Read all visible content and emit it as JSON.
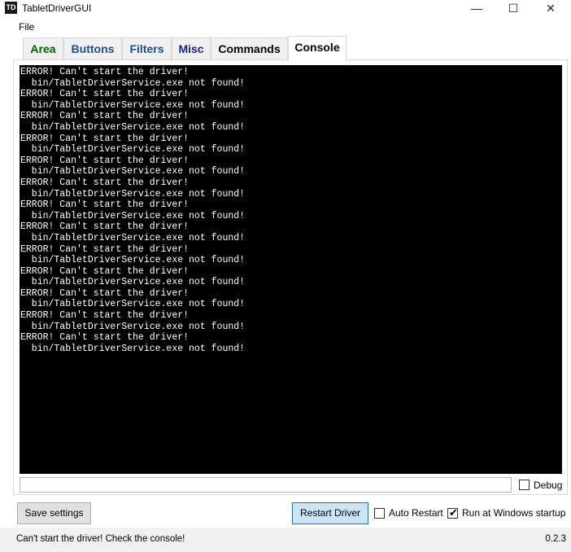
{
  "window": {
    "icon_text": "TD",
    "title": "TabletDriverGUI",
    "minimize": "—",
    "maximize": "☐",
    "close": "✕"
  },
  "menu": {
    "file": "File"
  },
  "tabs": [
    {
      "label": "Area",
      "color": "#006400"
    },
    {
      "label": "Buttons",
      "color": "#1f4e8c"
    },
    {
      "label": "Filters",
      "color": "#1f4e8c"
    },
    {
      "label": "Misc",
      "color": "#1a237e"
    },
    {
      "label": "Commands",
      "color": "#000000"
    },
    {
      "label": "Console",
      "color": "#000000",
      "active": true
    }
  ],
  "console": {
    "text": "ERROR! Can't start the driver!\n  bin/TabletDriverService.exe not found!\nERROR! Can't start the driver!\n  bin/TabletDriverService.exe not found!\nERROR! Can't start the driver!\n  bin/TabletDriverService.exe not found!\nERROR! Can't start the driver!\n  bin/TabletDriverService.exe not found!\nERROR! Can't start the driver!\n  bin/TabletDriverService.exe not found!\nERROR! Can't start the driver!\n  bin/TabletDriverService.exe not found!\nERROR! Can't start the driver!\n  bin/TabletDriverService.exe not found!\nERROR! Can't start the driver!\n  bin/TabletDriverService.exe not found!\nERROR! Can't start the driver!\n  bin/TabletDriverService.exe not found!\nERROR! Can't start the driver!\n  bin/TabletDriverService.exe not found!\nERROR! Can't start the driver!\n  bin/TabletDriverService.exe not found!\nERROR! Can't start the driver!\n  bin/TabletDriverService.exe not found!\nERROR! Can't start the driver!\n  bin/TabletDriverService.exe not found!",
    "input_value": "",
    "debug_label": "Debug",
    "debug_checked": false
  },
  "bottom": {
    "save_settings": "Save settings",
    "restart_driver": "Restart Driver",
    "auto_restart_label": "Auto Restart",
    "auto_restart_checked": false,
    "run_startup_label": "Run at Windows startup",
    "run_startup_checked": true,
    "check_mark": "✔"
  },
  "status": {
    "message": "Can't start the driver! Check the console!",
    "version": "0.2.3"
  }
}
